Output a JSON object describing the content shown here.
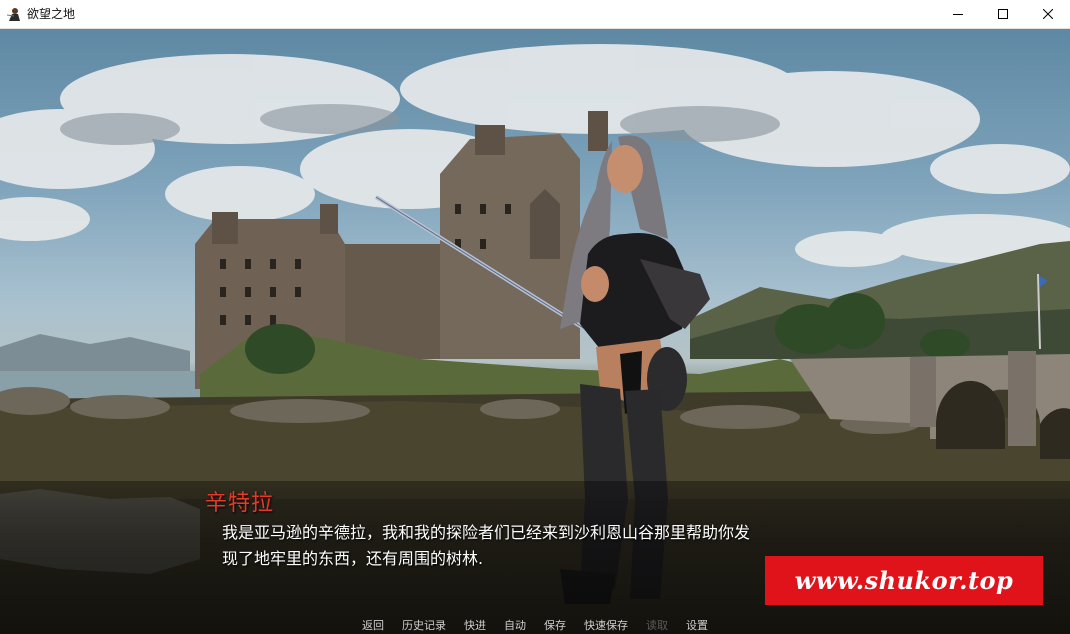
{
  "window": {
    "title": "欲望之地",
    "icon": "game-avatar-icon",
    "controls": {
      "minimize": "minimize-icon",
      "maximize": "maximize-icon",
      "close": "close-icon"
    }
  },
  "dialogue": {
    "speaker": "辛特拉",
    "line1": "我是亚马逊的辛德拉，我和我的探险者们已经来到沙利恩山谷那里帮助你发",
    "line2": "现了地牢里的东西，还有周围的树林."
  },
  "watermark": {
    "text": "www.shukor.top"
  },
  "quick_menu": {
    "items": [
      {
        "label": "返回",
        "enabled": true
      },
      {
        "label": "历史记录",
        "enabled": true
      },
      {
        "label": "快进",
        "enabled": true
      },
      {
        "label": "自动",
        "enabled": true
      },
      {
        "label": "保存",
        "enabled": true
      },
      {
        "label": "快速保存",
        "enabled": true
      },
      {
        "label": "读取",
        "enabled": false
      },
      {
        "label": "设置",
        "enabled": true
      }
    ]
  },
  "colors": {
    "speaker_name": "#e53a2a",
    "watermark_bg": "#e0121a",
    "quick_menu_text": "#cfcfcf",
    "quick_menu_disabled": "#5a5a5a"
  }
}
